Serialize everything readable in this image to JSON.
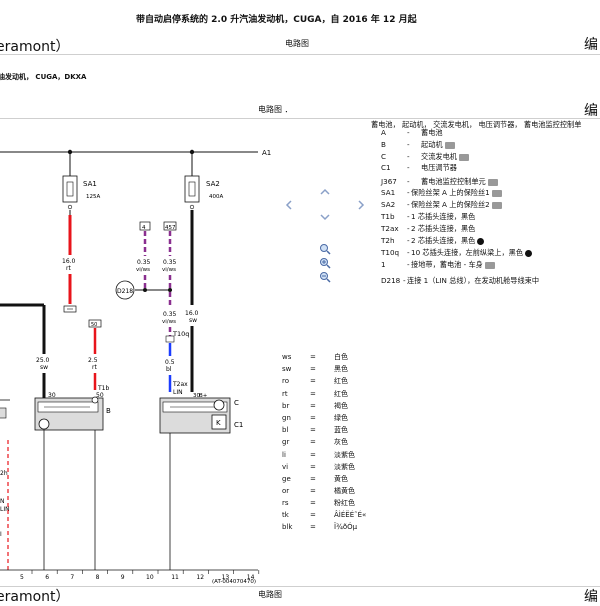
{
  "header": {
    "doc_title": "带自动启停系统的 2.0 升汽油发动机，CUGA，自 2016 年 12 月起",
    "left_fragment_1": "eramont）",
    "center_label_1": "电路图",
    "right_fragment_1": "编",
    "sub_title": "油发动机， CUGA，DKXA",
    "center_label_2": "电路图 ．",
    "right_fragment_2": "编 ·"
  },
  "footer": {
    "left_fragment": "eramont）",
    "center_label": "电路图",
    "right_fragment": "编"
  },
  "nav_icons": [
    "arrow-up-icon",
    "arrow-left-icon",
    "arrow-right-icon",
    "arrow-down-icon"
  ],
  "zoom_icons": [
    "zoom-fit-icon",
    "zoom-in-icon",
    "zoom-out-icon"
  ],
  "diagram": {
    "bus_label": "A1",
    "fuse1": {
      "name": "SA1",
      "rating": "125A"
    },
    "fuse2": {
      "name": "SA2",
      "rating": "400A"
    },
    "wire_16_rt": {
      "size": "16.0",
      "color": "rt"
    },
    "wire_016_sw": {
      "size": "16.0",
      "color": "sw"
    },
    "wire_25_sw": {
      "size": "25.0",
      "color": "sw"
    },
    "wire_25_rt": {
      "size": "2.5",
      "color": "rt"
    },
    "wire_035_a": {
      "size": "0.35",
      "color": "vi/ws"
    },
    "wire_035_b": {
      "size": "0.35",
      "color": "vi/ws"
    },
    "wire_035_c": {
      "size": "0.35",
      "color": "vi/ws"
    },
    "wire_05_bl": {
      "size": "0.5",
      "color": "bl"
    },
    "conn_tag_1": "4",
    "conn_tag_2": "457",
    "conn_tag_3": "50",
    "node_label": "D218",
    "t10q": "T10q",
    "t2ax": "T2ax",
    "lin": "LIN",
    "t1b": "T1b",
    "b_pin_30": "30",
    "b_pin_50": "50",
    "c_pin_30": "30",
    "c_pin_b": "B+",
    "comp_B": "B",
    "comp_C": "C",
    "comp_C1": "C1",
    "left_label_1": "2h",
    "left_label_2": "N",
    "left_label_3": "LIN",
    "gauge_label": "I",
    "ruler": [
      "5",
      "6",
      "7",
      "8",
      "9",
      "10",
      "11",
      "12",
      "13",
      "14"
    ],
    "code": "(AT-004070470)"
  },
  "components": {
    "title": "蓄电池， 起动机， 交流发电机， 电压调节器， 蓄电池监控控制单",
    "rows": [
      {
        "code": "A",
        "dash": "-",
        "text": "蓄电池",
        "icon": ""
      },
      {
        "code": "B",
        "dash": "-",
        "text": "起动机",
        "icon": "camera-icon"
      },
      {
        "code": "C",
        "dash": "-",
        "text": "交流发电机",
        "icon": "camera-icon"
      },
      {
        "code": "C1",
        "dash": "-",
        "text": "电压调节器",
        "icon": ""
      },
      {
        "code": "J367",
        "dash": "-",
        "text": "蓄电池监控控制单元",
        "icon": "camera-icon"
      },
      {
        "code": "SA1",
        "dash": "-",
        "text": "保险丝架 A 上的保险丝1",
        "icon": "camera-icon"
      },
      {
        "code": "SA2",
        "dash": "-",
        "text": "保险丝架 A 上的保险丝2",
        "icon": "camera-icon"
      },
      {
        "code": "T1b",
        "dash": "-",
        "text": "1 芯插头连接，黑色",
        "icon": ""
      },
      {
        "code": "T2ax",
        "dash": "-",
        "text": "2 芯插头连接，黑色",
        "icon": ""
      },
      {
        "code": "T2h",
        "dash": "-",
        "text": "2 芯插头连接，黑色",
        "icon": "camera-icon"
      },
      {
        "code": "T10q",
        "dash": "-",
        "text": "10 芯插头连接，左前纵梁上，黑色",
        "icon": "camera-icon"
      },
      {
        "code": "1",
        "dash": "-",
        "text": "接地带，蓄电池 - 车身",
        "icon": "camera-icon"
      },
      {
        "code": "D218",
        "dash": "-",
        "text": "连接 1（LIN 总线），在发动机舱导线束中",
        "icon": ""
      }
    ]
  },
  "legend": [
    {
      "code": "ws",
      "eq": "=",
      "name": "白色"
    },
    {
      "code": "sw",
      "eq": "=",
      "name": "黑色"
    },
    {
      "code": "ro",
      "eq": "=",
      "name": "红色"
    },
    {
      "code": "rt",
      "eq": "=",
      "name": "红色"
    },
    {
      "code": "br",
      "eq": "=",
      "name": "褐色"
    },
    {
      "code": "gn",
      "eq": "=",
      "name": "绿色"
    },
    {
      "code": "bl",
      "eq": "=",
      "name": "蓝色"
    },
    {
      "code": "gr",
      "eq": "=",
      "name": "灰色"
    },
    {
      "code": "li",
      "eq": "=",
      "name": "淡紫色"
    },
    {
      "code": "vi",
      "eq": "=",
      "name": "淡紫色"
    },
    {
      "code": "ge",
      "eq": "=",
      "name": "黄色"
    },
    {
      "code": "or",
      "eq": "=",
      "name": "橘黄色"
    },
    {
      "code": "rs",
      "eq": "=",
      "name": "粉红色"
    },
    {
      "code": "tk",
      "eq": "=",
      "name": "ÂÌÉËÉ˜É«"
    },
    {
      "code": "blk",
      "eq": "=",
      "name": "Ï¾ðÓµ"
    }
  ],
  "colors": {
    "red": "#e8141b",
    "black": "#111111",
    "blue": "#1b3cff",
    "violet": "#8a2f8f",
    "gray": "#cfcfcf"
  }
}
